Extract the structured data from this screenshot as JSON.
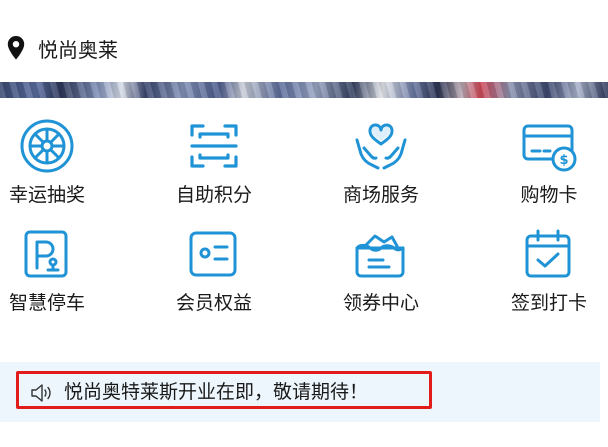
{
  "header": {
    "location_name": "悦尚奥莱",
    "location_icon": "map-pin-icon"
  },
  "services": [
    {
      "label": "幸运抽奖",
      "icon": "lucky-wheel-icon"
    },
    {
      "label": "自助积分",
      "icon": "scan-icon"
    },
    {
      "label": "商场服务",
      "icon": "heart-hands-icon"
    },
    {
      "label": "购物卡",
      "icon": "shopping-card-icon"
    },
    {
      "label": "智慧停车",
      "icon": "parking-icon"
    },
    {
      "label": "会员权益",
      "icon": "member-card-icon"
    },
    {
      "label": "领券中心",
      "icon": "coupon-wallet-icon"
    },
    {
      "label": "签到打卡",
      "icon": "calendar-check-icon"
    }
  ],
  "notice": {
    "text": "悦尚奥特莱斯开业在即，敬请期待！",
    "icon": "speaker-icon"
  },
  "colors": {
    "icon_blue": "#1f93d6",
    "notice_bg": "#edf6fc",
    "highlight_red": "#e21b1b"
  }
}
